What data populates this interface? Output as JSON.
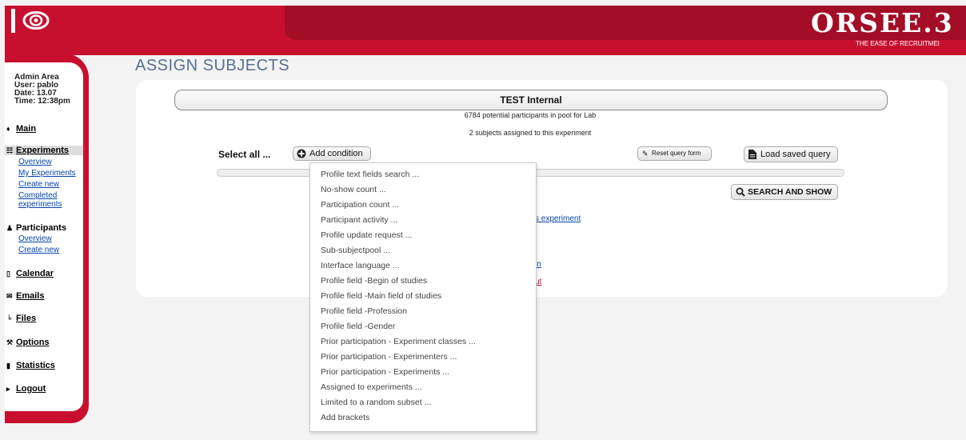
{
  "header": {
    "brand": "ORSEE.3",
    "tagline": "THE EASE OF RECRUITMEI",
    "colors": {
      "red": "#c8102e",
      "dark_red": "#a30d26",
      "link_blue": "#0645ad"
    }
  },
  "admin": {
    "area": "Admin Area",
    "user": "User: pablo",
    "date": "Date: 13.07",
    "time": "Time: 12:38pm"
  },
  "nav": {
    "main": "Main",
    "experiments": "Experiments",
    "experiments_sub": [
      "Overview",
      "My Experiments",
      "Create new",
      "Completed",
      "experiments"
    ],
    "participants": "Participants",
    "participants_sub": [
      "Overview",
      "Create new"
    ],
    "calendar": "Calendar",
    "emails": "Emails",
    "files": "Files",
    "options": "Options",
    "statistics": "Statistics",
    "logout": "Logout"
  },
  "page": {
    "title": "ASSIGN SUBJECTS",
    "experiment_name": "TEST Internal",
    "pool_info": "6784 potential participants in pool for Lab",
    "assigned_info": "2 subjects assigned to this experiment",
    "select_all": "Select all ...",
    "add_condition": "Add condition",
    "reset_query": "Reset query form",
    "load_saved": "Load saved query",
    "search_show": "SEARCH AND SHOW",
    "partial_link_1": "s experiment",
    "partial_link_2": "in",
    "partial_link_3": "ut"
  },
  "dropdown": {
    "items": [
      "Profile text fields search ...",
      "No-show count ...",
      "Participation count ...",
      "Participant activity ...",
      "Profile update request ...",
      "Sub-subjectpool ...",
      "Interface language ...",
      "Profile field -Begin of studies",
      "Profile field -Main field of studies",
      "Profile field -Profession",
      "Profile field -Gender",
      "Prior participation - Experiment classes ...",
      "Prior participation - Experimenters ...",
      "Prior participation - Experiments ...",
      "Assigned to experiments ...",
      "Limited to a random subset ...",
      "Add brackets"
    ]
  },
  "icons": [
    "eye-logo-icon",
    "plus-circle-icon",
    "eraser-icon",
    "document-icon",
    "magnifier-icon"
  ]
}
